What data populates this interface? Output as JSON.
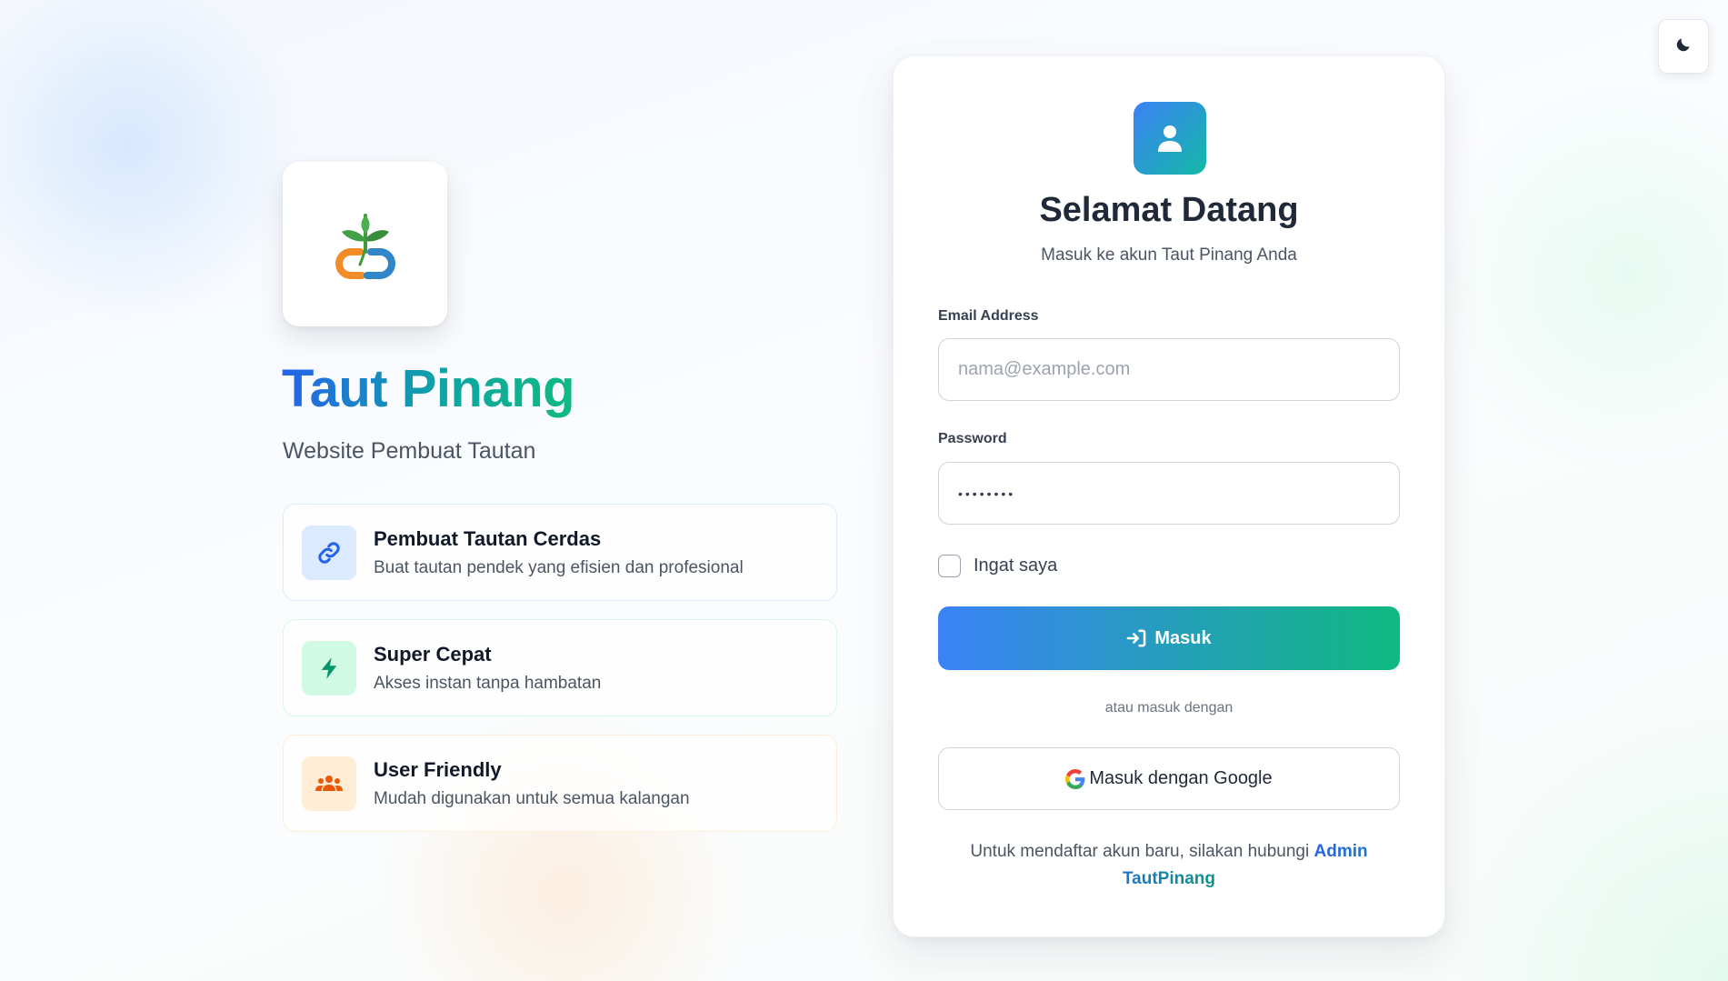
{
  "theme_toggle": {
    "icon": "moon-icon"
  },
  "brand": {
    "logo_icon": "taut-pinang-logo",
    "title": "Taut Pinang",
    "subtitle": "Website Pembuat Tautan"
  },
  "features": [
    {
      "icon": "link-icon",
      "title": "Pembuat Tautan Cerdas",
      "description": "Buat tautan pendek yang efisien dan profesional",
      "accent": "#2563eb"
    },
    {
      "icon": "bolt-icon",
      "title": "Super Cepat",
      "description": "Akses instan tanpa hambatan",
      "accent": "#059669"
    },
    {
      "icon": "users-icon",
      "title": "User Friendly",
      "description": "Mudah digunakan untuk semua kalangan",
      "accent": "#ea580c"
    }
  ],
  "login": {
    "avatar_icon": "user-icon",
    "title": "Selamat Datang",
    "subtitle": "Masuk ke akun Taut Pinang Anda",
    "email": {
      "label": "Email Address",
      "placeholder": "nama@example.com",
      "value": ""
    },
    "password": {
      "label": "Password",
      "value": "••••••••"
    },
    "remember_label": "Ingat saya",
    "remember_checked": false,
    "submit_label": "Masuk",
    "submit_icon": "sign-in-icon",
    "divider_text": "atau masuk dengan",
    "google_label": "Masuk dengan Google",
    "google_icon": "google-icon",
    "register_text": "Untuk mendaftar akun baru, silakan hubungi",
    "admin_link_label": "Admin TautPinang"
  },
  "colors": {
    "primary_blue": "#3b82f6",
    "primary_green": "#10b981",
    "text_dark": "#1f2937"
  }
}
